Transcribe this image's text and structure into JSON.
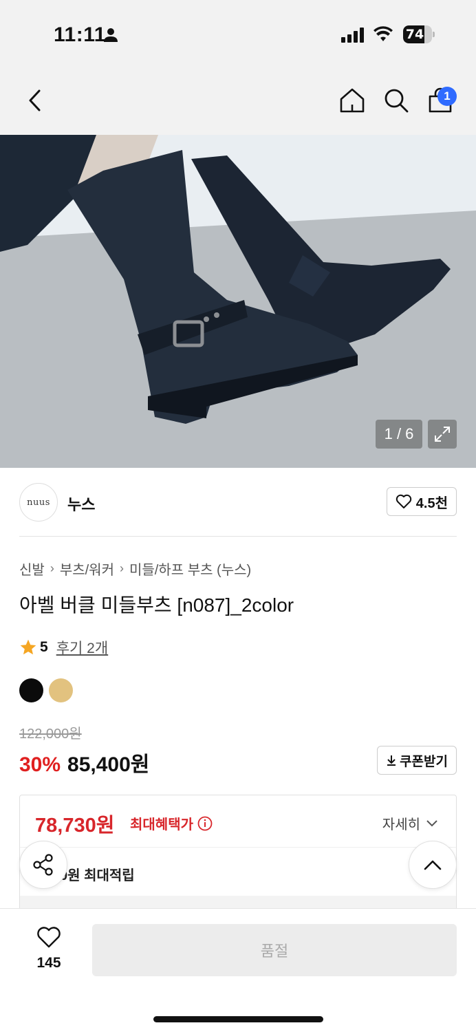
{
  "status_bar": {
    "time": "11:11",
    "battery": "74",
    "battery_level": 0.74
  },
  "nav": {
    "cart_count": "1"
  },
  "gallery": {
    "counter": "1 / 6"
  },
  "brand": {
    "logo_text": "nuus",
    "name": "누스",
    "likes": "4.5천"
  },
  "breadcrumb": [
    "신발",
    "부츠/워커",
    "미들/하프 부츠 (누스)"
  ],
  "product": {
    "title": "아벨 버클 미들부츠 [n087]_2color",
    "rating": "5",
    "reviews": "후기 2개",
    "colors": [
      "#0b0b0b",
      "#e2c27f"
    ],
    "original_price": "122,000원",
    "discount": "30%",
    "price": "85,400원",
    "coupon_label": "쿠폰받기"
  },
  "benefit": {
    "max_price": "78,730원",
    "max_label": "최대혜택가",
    "detail_label": "자세히",
    "point_text": "0원 최대적립"
  },
  "bottom": {
    "wish_count": "145",
    "soldout_label": "품절"
  }
}
